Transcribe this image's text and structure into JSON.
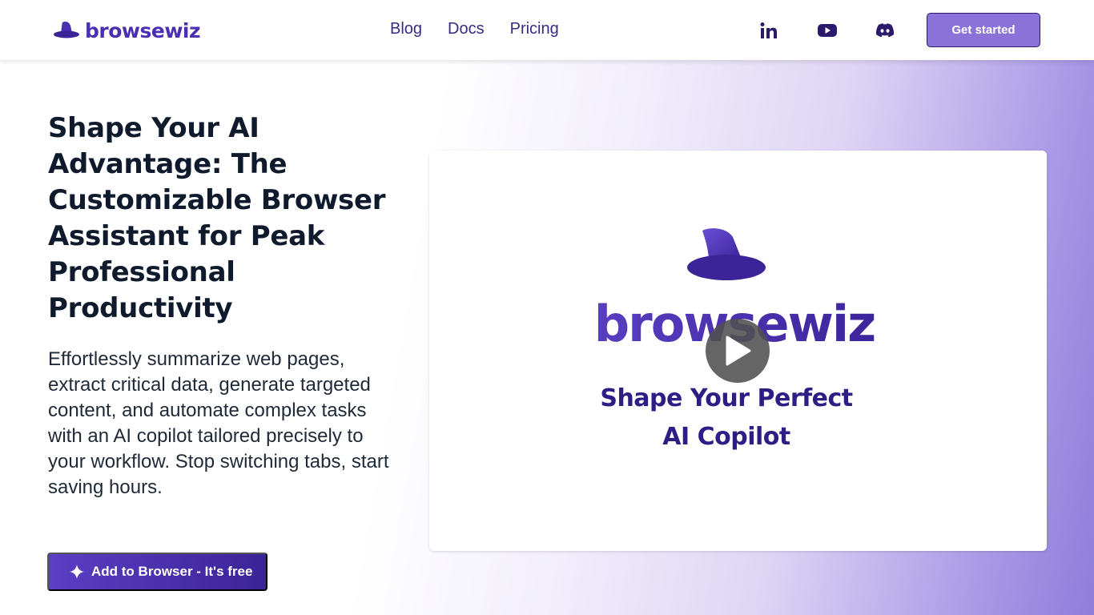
{
  "brand": {
    "name": "browsewiz",
    "color": "#4a2fb0"
  },
  "nav": {
    "items": [
      {
        "label": "Blog"
      },
      {
        "label": "Docs"
      },
      {
        "label": "Pricing"
      }
    ]
  },
  "social": {
    "icons": [
      "linkedin-icon",
      "youtube-icon",
      "discord-icon"
    ]
  },
  "header_cta": {
    "label": "Get started",
    "color": "#8a72d8"
  },
  "hero": {
    "headline": "Shape Your AI Advantage: The Customizable Browser Assistant for Peak Professional Productivity",
    "subtext": "Effortlessly summarize web pages, extract critical data, generate targeted content, and automate complex tasks with an AI copilot tailored precisely to your workflow. Stop switching tabs, start saving hours.",
    "cta_label": "Add to Browser - It's free",
    "cta_icon": "sparkle-icon"
  },
  "video": {
    "brand": "browsewiz",
    "tagline_line1": "Shape Your Perfect",
    "tagline_line2": "AI Copilot",
    "play_icon": "play-icon"
  },
  "colors": {
    "accent": "#5b3fc4",
    "dark_accent": "#2b1a6b",
    "text": "#0f1b2d"
  }
}
